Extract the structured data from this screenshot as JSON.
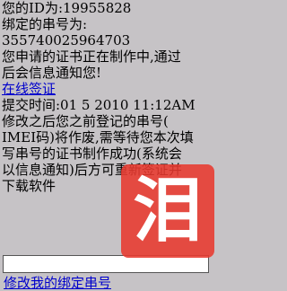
{
  "lines": [
    "您的ID为:19955828",
    "绑定的串号为:",
    "355740025964703",
    "您申请的证书正在制作中,通过",
    "后会信息通知您!"
  ],
  "online_sign_link": "在线签证",
  "submit_time": "提交时间:01 5 2010 11:12AM",
  "notice_lines": [
    "修改之后您之前登记的串号(",
    "IMEI码)将作废,需等待您本次填",
    "写串号的证书制作成功(系统会",
    "以信息通知)后方可重新签证并",
    "下载软件"
  ],
  "imei_input": {
    "value": "",
    "placeholder": ""
  },
  "modify_link": "修改我的绑定串号",
  "watermark": {
    "glyph": "泪",
    "color": "#e8392f"
  }
}
